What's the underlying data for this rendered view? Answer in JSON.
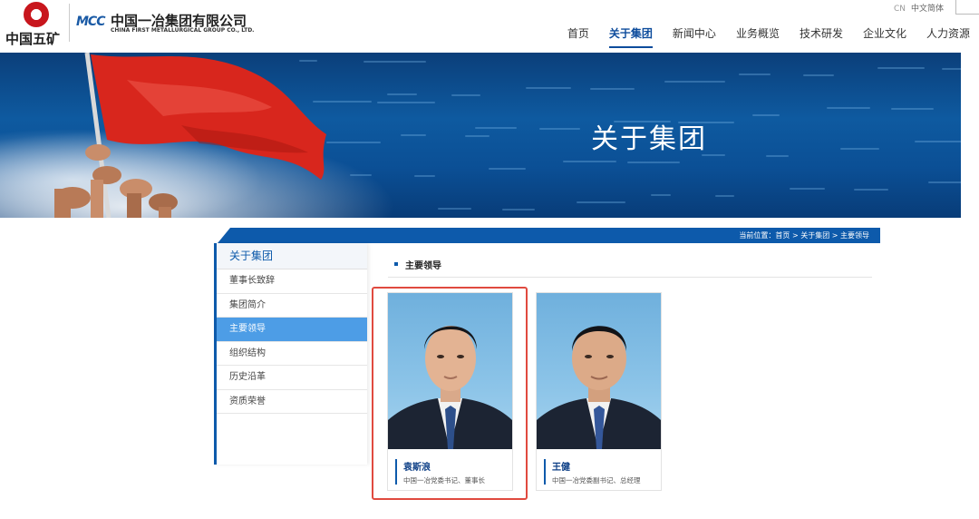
{
  "header": {
    "logo_left_text": "中国五矿",
    "logo_mcc_mark": "MCC",
    "logo_mcc_cn": "中国一冶集团有限公司",
    "logo_mcc_en": "CHINA FIRST METALLURGICAL GROUP CO., LTD.",
    "lang_cn": "CN",
    "lang_label": "中文简体"
  },
  "nav": {
    "items": [
      "首页",
      "关于集团",
      "新闻中心",
      "业务概览",
      "技术研发",
      "企业文化",
      "人力资源"
    ],
    "active_index": 1
  },
  "banner": {
    "title": "关于集团"
  },
  "breadcrumb": {
    "text": "当前位置：首页 > 关于集团 > 主要领导"
  },
  "sidebar": {
    "title": "关于集团",
    "items": [
      "董事长致辞",
      "集团简介",
      "主要领导",
      "组织结构",
      "历史沿革",
      "资质荣誉"
    ],
    "active_index": 2
  },
  "section": {
    "title": "主要领导"
  },
  "leaders": [
    {
      "name": "袁斯浪",
      "title": "中国一冶党委书记、董事长"
    },
    {
      "name": "王健",
      "title": "中国一冶党委副书记、总经理"
    }
  ],
  "colors": {
    "brand_blue": "#0d5aab",
    "active_blue": "#4d9de6",
    "highlight_red": "#e04a3f",
    "flag_red": "#d8261d"
  }
}
